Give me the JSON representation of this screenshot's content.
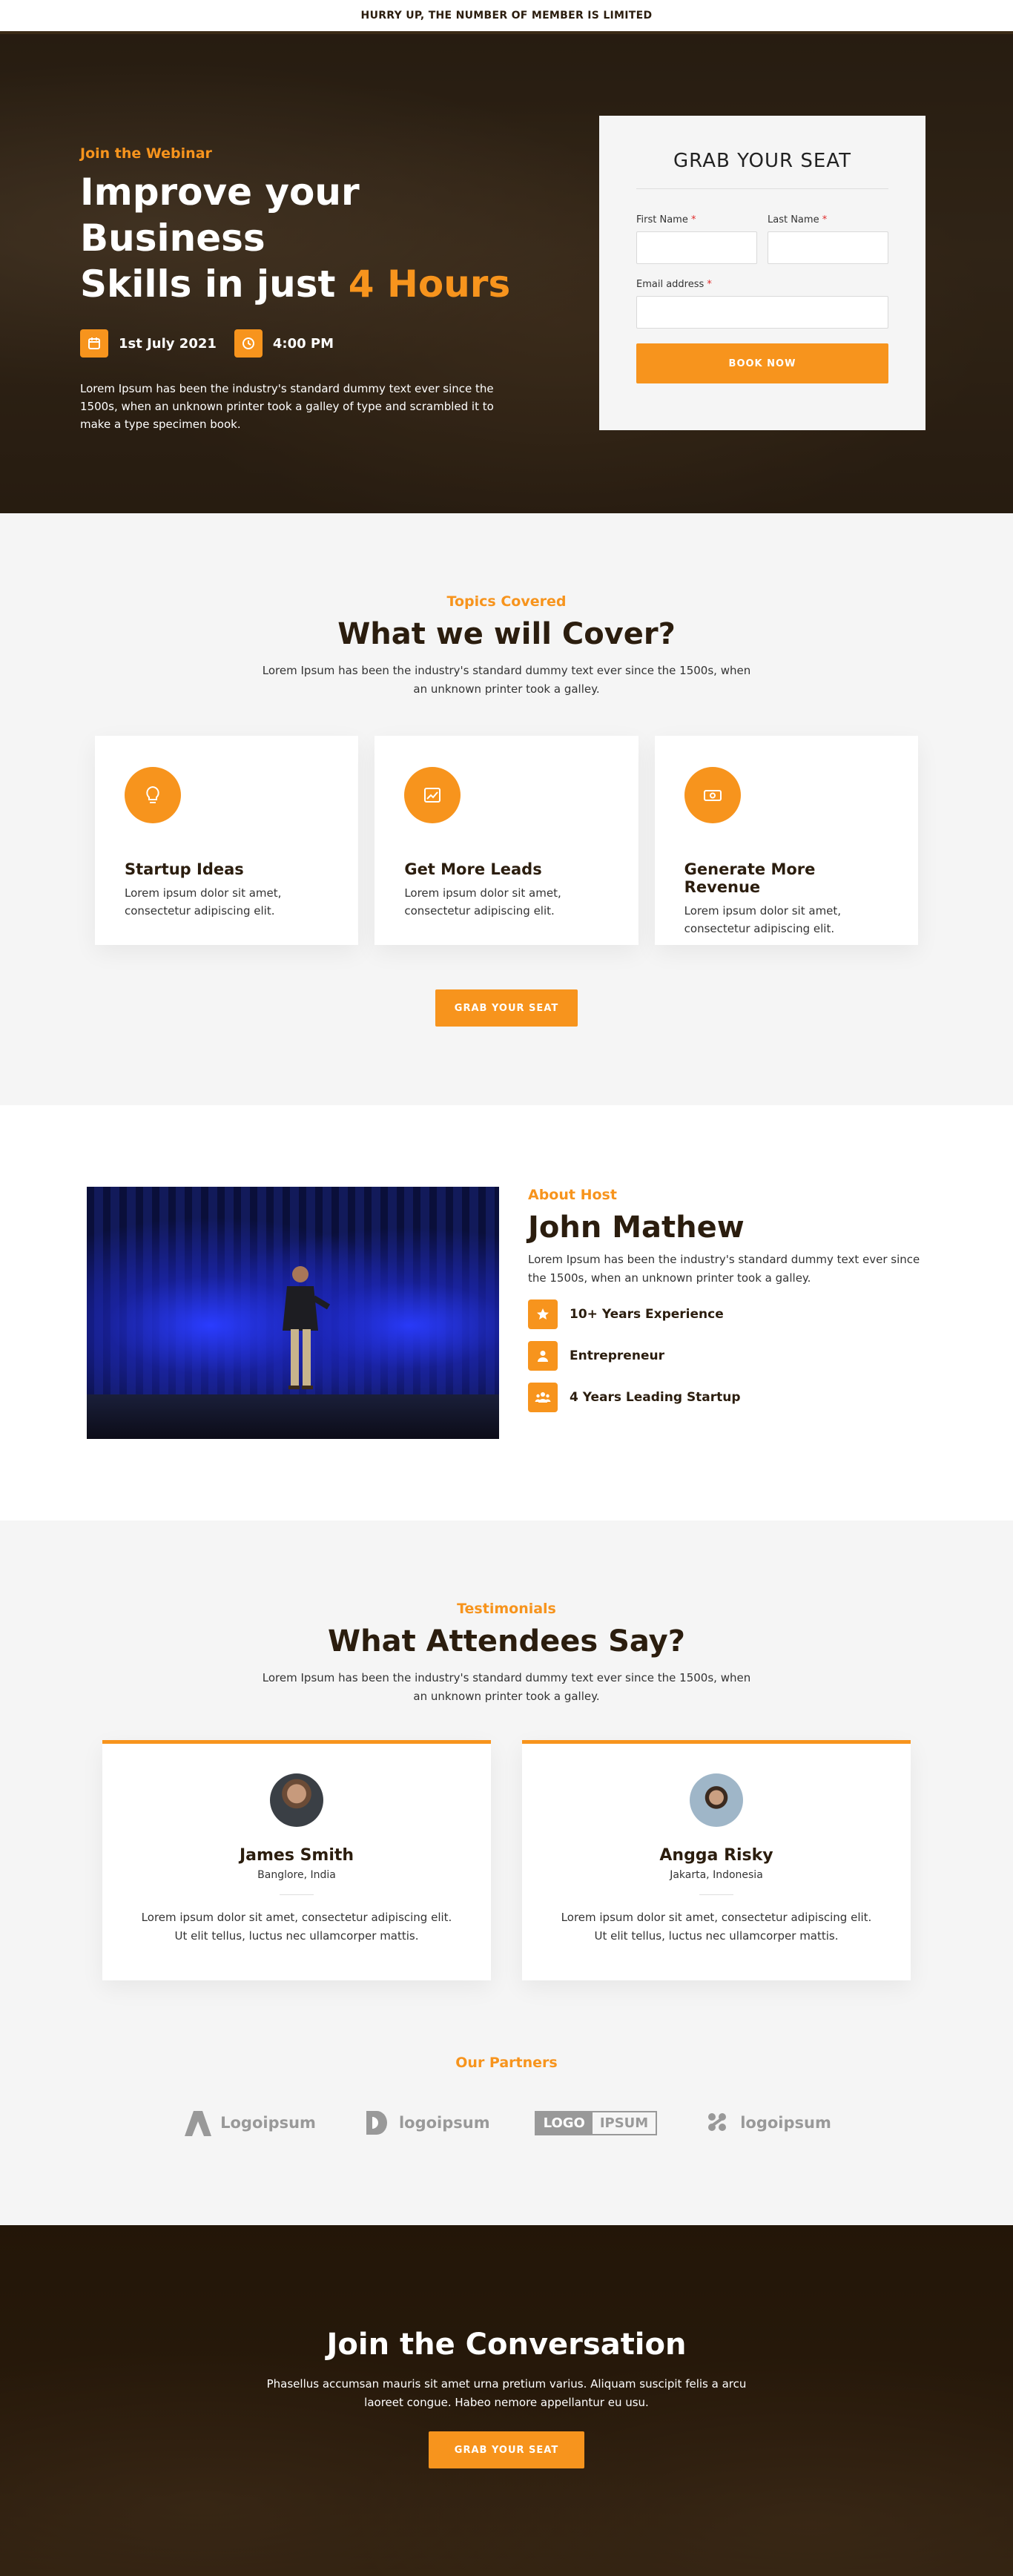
{
  "topbar": {
    "text": "HURRY UP, THE NUMBER OF MEMBER IS LIMITED"
  },
  "hero": {
    "eyebrow": "Join the Webinar",
    "title_line1": "Improve your Business",
    "title_line2_prefix": "Skills in just ",
    "title_accent": "4 Hours",
    "date": "1st July 2021",
    "time": "4:00 PM",
    "description": "Lorem Ipsum has been the industry's standard dummy text ever since the 1500s, when an unknown printer took a galley of type and scrambled it to make a type specimen book."
  },
  "form": {
    "title": "GRAB YOUR SEAT",
    "first_name_label": "First Name",
    "last_name_label": "Last Name",
    "email_label": "Email address",
    "required_mark": "*",
    "submit_label": "BOOK NOW"
  },
  "topics": {
    "eyebrow": "Topics Covered",
    "title": "What we will Cover?",
    "lead": "Lorem Ipsum has been the industry's standard dummy text ever since the 1500s, when an unknown printer took a galley.",
    "cards": [
      {
        "title": "Startup Ideas",
        "text": "Lorem ipsum dolor sit amet, consectetur adipiscing elit.",
        "icon": "lightbulb-icon"
      },
      {
        "title": "Get More Leads",
        "text": "Lorem ipsum dolor sit amet, consectetur adipiscing elit.",
        "icon": "chart-icon"
      },
      {
        "title": "Generate More Revenue",
        "text": "Lorem ipsum dolor sit amet, consectetur adipiscing elit.",
        "icon": "money-icon"
      }
    ],
    "cta_label": "GRAB YOUR SEAT"
  },
  "host": {
    "eyebrow": "About Host",
    "name": "John Mathew",
    "bio": "Lorem Ipsum has been the industry's standard dummy text ever since the 1500s, when an unknown printer took a galley.",
    "features": [
      {
        "label": "10+ Years Experience",
        "icon": "star-icon"
      },
      {
        "label": "Entrepreneur",
        "icon": "user-icon"
      },
      {
        "label": "4 Years Leading Startup",
        "icon": "users-icon"
      }
    ]
  },
  "testimonials": {
    "eyebrow": "Testimonials",
    "title": "What Attendees Say?",
    "lead": "Lorem Ipsum has been the industry's standard dummy text ever since the 1500s, when an unknown printer took a galley.",
    "items": [
      {
        "name": "James Smith",
        "location": "Banglore, India",
        "quote": "Lorem ipsum dolor sit amet, consectetur adipiscing elit. Ut elit tellus, luctus nec ullamcorper mattis."
      },
      {
        "name": "Angga Risky",
        "location": "Jakarta, Indonesia",
        "quote": "Lorem ipsum dolor sit amet, consectetur adipiscing elit. Ut elit tellus, luctus nec ullamcorper mattis."
      }
    ]
  },
  "partners": {
    "title": "Our Partners",
    "logos": [
      "Logoipsum",
      "logoipsum",
      "LOGO",
      "IPSUM",
      "logoipsum"
    ]
  },
  "cta": {
    "title": "Join the Conversation",
    "text": "Phasellus accumsan mauris sit amet urna pretium varius. Aliquam suscipit felis a arcu laoreet congue. Habeo nemore appellantur eu usu.",
    "button_label": "GRAB YOUR SEAT"
  },
  "colors": {
    "accent": "#f7941d",
    "dark": "#2b1d0e",
    "gray_bg": "#f5f5f5"
  }
}
